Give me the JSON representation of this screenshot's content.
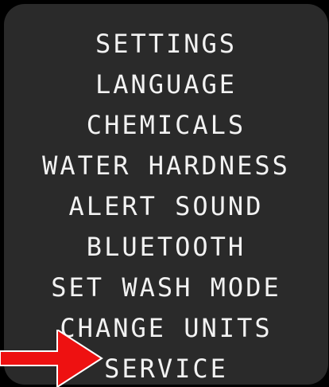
{
  "menu": {
    "items": [
      {
        "label": "SETTINGS"
      },
      {
        "label": "LANGUAGE"
      },
      {
        "label": "CHEMICALS"
      },
      {
        "label": "WATER HARDNESS"
      },
      {
        "label": "ALERT SOUND"
      },
      {
        "label": "BLUETOOTH"
      },
      {
        "label": "SET WASH MODE"
      },
      {
        "label": "CHANGE UNITS"
      },
      {
        "label": "SERVICE"
      }
    ]
  },
  "pointer": {
    "icon": "arrow-right-icon",
    "color": "#ee1111",
    "target": "SERVICE"
  },
  "colors": {
    "screen_background": "#2a2a2a",
    "text": "#f2f2f2"
  }
}
